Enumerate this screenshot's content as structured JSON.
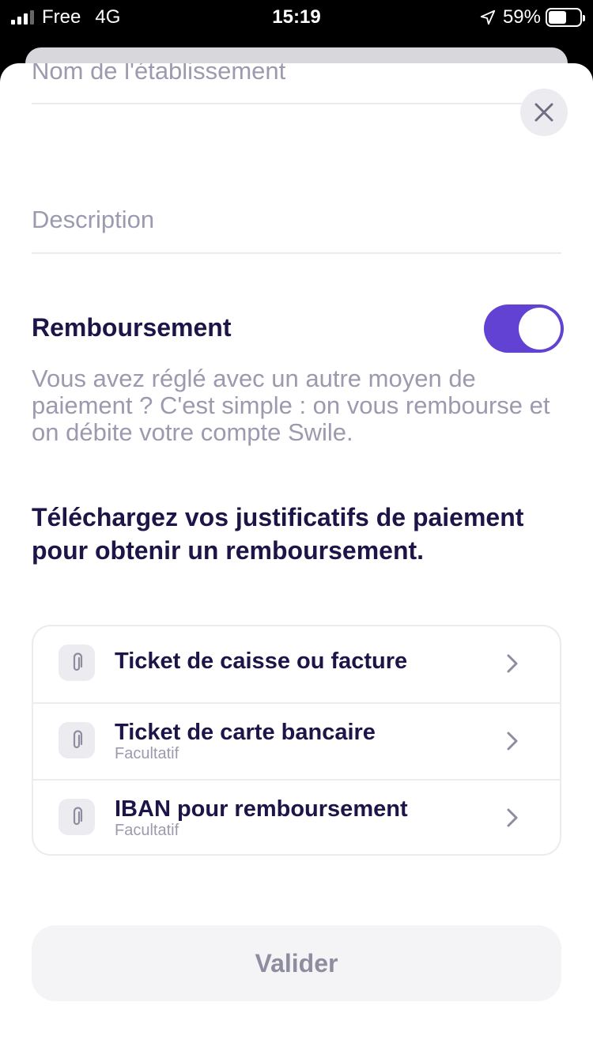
{
  "status_bar": {
    "carrier": "Free",
    "network": "4G",
    "time": "15:19",
    "battery": "59%",
    "battery_level": 0.59
  },
  "form": {
    "name_placeholder": "Nom de l'établissement",
    "description_placeholder": "Description"
  },
  "reimbursement": {
    "title": "Remboursement",
    "enabled": true,
    "description": "Vous avez réglé avec un autre moyen de paiement ? C'est simple : on vous rembourse et on débite votre compte Swile."
  },
  "upload": {
    "title": "Téléchargez vos justificatifs de paiement pour obtenir un remboursement.",
    "items": [
      {
        "label": "Ticket de caisse ou facture",
        "sub": "",
        "icon": "paperclip-icon"
      },
      {
        "label": "Ticket de carte bancaire",
        "sub": "Facultatif",
        "icon": "paperclip-icon"
      },
      {
        "label": "IBAN pour remboursement",
        "sub": "Facultatif",
        "icon": "paperclip-icon"
      }
    ]
  },
  "submit_label": "Valider",
  "colors": {
    "accent": "#6142d3",
    "heading": "#1e1448",
    "muted": "#9b9aae"
  }
}
